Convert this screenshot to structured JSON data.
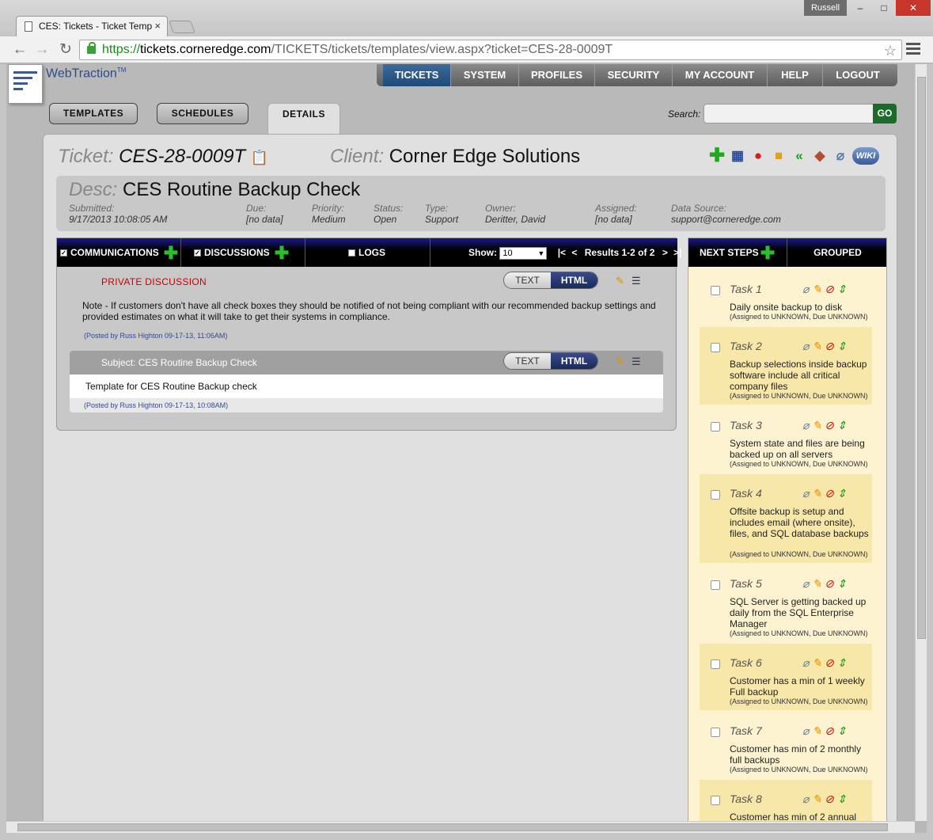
{
  "browser": {
    "tab_title": "CES: Tickets - Ticket Temp",
    "tab_close": "×",
    "user": "Russell",
    "url_https": "https://",
    "url_host": "tickets.corneredge.com",
    "url_path": "/TICKETS/tickets/templates/view.aspx?ticket=CES-28-0009T",
    "win_min": "–",
    "win_max": "□",
    "win_close": "✕"
  },
  "app": {
    "logo": "WebTraction",
    "logo_tm": "TM",
    "nav": [
      "TICKETS",
      "SYSTEM",
      "PROFILES",
      "SECURITY",
      "MY ACCOUNT",
      "HELP",
      "LOGOUT"
    ],
    "active_nav": "TICKETS"
  },
  "tabs": {
    "templates": "TEMPLATES",
    "schedules": "SCHEDULES",
    "details": "DETAILS"
  },
  "search": {
    "label": "Search:",
    "go": "GO",
    "placeholder": ""
  },
  "ticket": {
    "ticket_label": "Ticket:",
    "ticket_id": "CES-28-0009T",
    "client_label": "Client:",
    "client_name": "Corner Edge Solutions",
    "wiki": "WIKI",
    "desc_label": "Desc:",
    "desc": "CES Routine Backup Check",
    "submitted_label": "Submitted:",
    "submitted": "9/17/2013 10:08:05 AM",
    "due_label": "Due:",
    "due": "[no data]",
    "priority_label": "Priority:",
    "priority": "Medium",
    "status_label": "Status:",
    "status": "Open",
    "type_label": "Type:",
    "type": "Support",
    "owner_label": "Owner:",
    "owner": "Deritter, David",
    "assigned_label": "Assigned:",
    "assigned": "[no data]",
    "source_label": "Data Source:",
    "source": "support@corneredge.com"
  },
  "comm": {
    "communications": "COMMUNICATIONS",
    "discussions": "DISCUSSIONS",
    "logs": "LOGS",
    "show_label": "Show:",
    "show_value": "10",
    "results": "Results 1-2 of 2",
    "first": "|<",
    "prev": "<",
    "next": ">",
    "last": ">|",
    "private_title": "PRIVATE DISCUSSION",
    "toggle_text": "TEXT",
    "toggle_html": "HTML",
    "note": "Note - If customers don't have all check boxes they should be notified of not being compliant with our recommended backup settings and provided estimates on what it will take to get their systems in compliance.",
    "posted1": "(Posted by Russ Highton 09-17-13, 11:06AM)",
    "subject": "Subject: CES Routine Backup Check",
    "body": "Template for CES Routine Backup check",
    "posted2": "(Posted by Russ Highton 09-17-13, 10:08AM)"
  },
  "next_steps": {
    "title": "NEXT STEPS",
    "grouped": "GROUPED",
    "tasks": [
      {
        "name": "Task 1",
        "desc": "Daily onsite backup to disk",
        "meta": "(Assigned to UNKNOWN, Due UNKNOWN)"
      },
      {
        "name": "Task 2",
        "desc": "Backup selections inside backup software include all critical company files",
        "meta": "(Assigned to UNKNOWN, Due UNKNOWN)"
      },
      {
        "name": "Task 3",
        "desc": "System state and files are being backed up on all servers",
        "meta": "(Assigned to UNKNOWN, Due UNKNOWN)"
      },
      {
        "name": "Task 4",
        "desc": "Offsite backup is setup and includes email (where onsite), files, and SQL database backups",
        "meta": "(Assigned to UNKNOWN, Due UNKNOWN)"
      },
      {
        "name": "Task 5",
        "desc": "SQL Server is getting backed up daily from the SQL Enterprise Manager",
        "meta": "(Assigned to UNKNOWN, Due UNKNOWN)"
      },
      {
        "name": "Task 6",
        "desc": "Customer has a min of 1 weekly Full backup",
        "meta": "(Assigned to UNKNOWN, Due UNKNOWN)"
      },
      {
        "name": "Task 7",
        "desc": "Customer has min of 2 monthly full backups",
        "meta": "(Assigned to UNKNOWN, Due UNKNOWN)"
      },
      {
        "name": "Task 8",
        "desc": "Customer has min of 2 annual",
        "meta": ""
      }
    ]
  },
  "colors": {
    "accent_green": "#2cbe2c",
    "header_navy": "#1a1a8a",
    "private_red": "#cc0000",
    "task_bg": "#f7e7a8"
  }
}
